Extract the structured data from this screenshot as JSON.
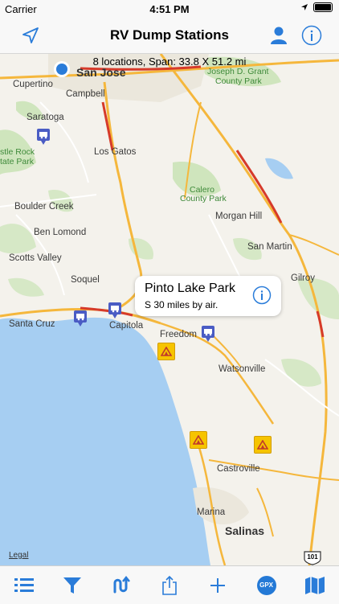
{
  "status_bar": {
    "carrier": "Carrier",
    "time": "4:51 PM"
  },
  "nav": {
    "title": "RV Dump Stations",
    "location_icon": "location-arrow-icon",
    "profile_icon": "person-icon",
    "info_icon": "info-icon"
  },
  "map": {
    "info": "8 locations, Span: 33.8 X 51.2 mi",
    "legal": "Legal",
    "highway": "101",
    "labels": {
      "cupertino": "Cupertino",
      "san_jose": "San Jose",
      "joseph_d_grant": "Joseph D. Grant",
      "county_park": "County Park",
      "campbell": "Campbell",
      "saratoga": "Saratoga",
      "castle_rock_1": "stle Rock",
      "castle_rock_2": "tate Park",
      "los_gatos": "Los Gatos",
      "calero_1": "Calero",
      "calero_2": "County Park",
      "boulder_creek": "Boulder Creek",
      "morgan_hill": "Morgan Hill",
      "ben_lomond": "Ben Lomond",
      "san_martin": "San Martin",
      "scotts_valley": "Scotts Valley",
      "soquel": "Soquel",
      "gilroy": "Gilroy",
      "santa_cruz": "Santa Cruz",
      "capitola": "Capitola",
      "freedom": "Freedom",
      "watsonville": "Watsonville",
      "castroville": "Castroville",
      "marina": "Marina",
      "salinas": "Salinas"
    }
  },
  "callout": {
    "title": "Pinto Lake Park",
    "subtitle": "S 30 miles by air."
  },
  "colors": {
    "accent": "#2a7cd9",
    "water": "#a6cef2",
    "land": "#f4f2ec",
    "park": "#cfe5bd",
    "freeway": "#f5b73c",
    "traffic": "#d63a2a",
    "pin": "#4a5cc4",
    "campground": "#f6c400"
  },
  "tab_bar": {
    "items": [
      "list-icon",
      "filter-icon",
      "route-icon",
      "share-icon",
      "add-icon",
      "gpx-button",
      "map-icon"
    ],
    "gpx_label": "GPX"
  }
}
